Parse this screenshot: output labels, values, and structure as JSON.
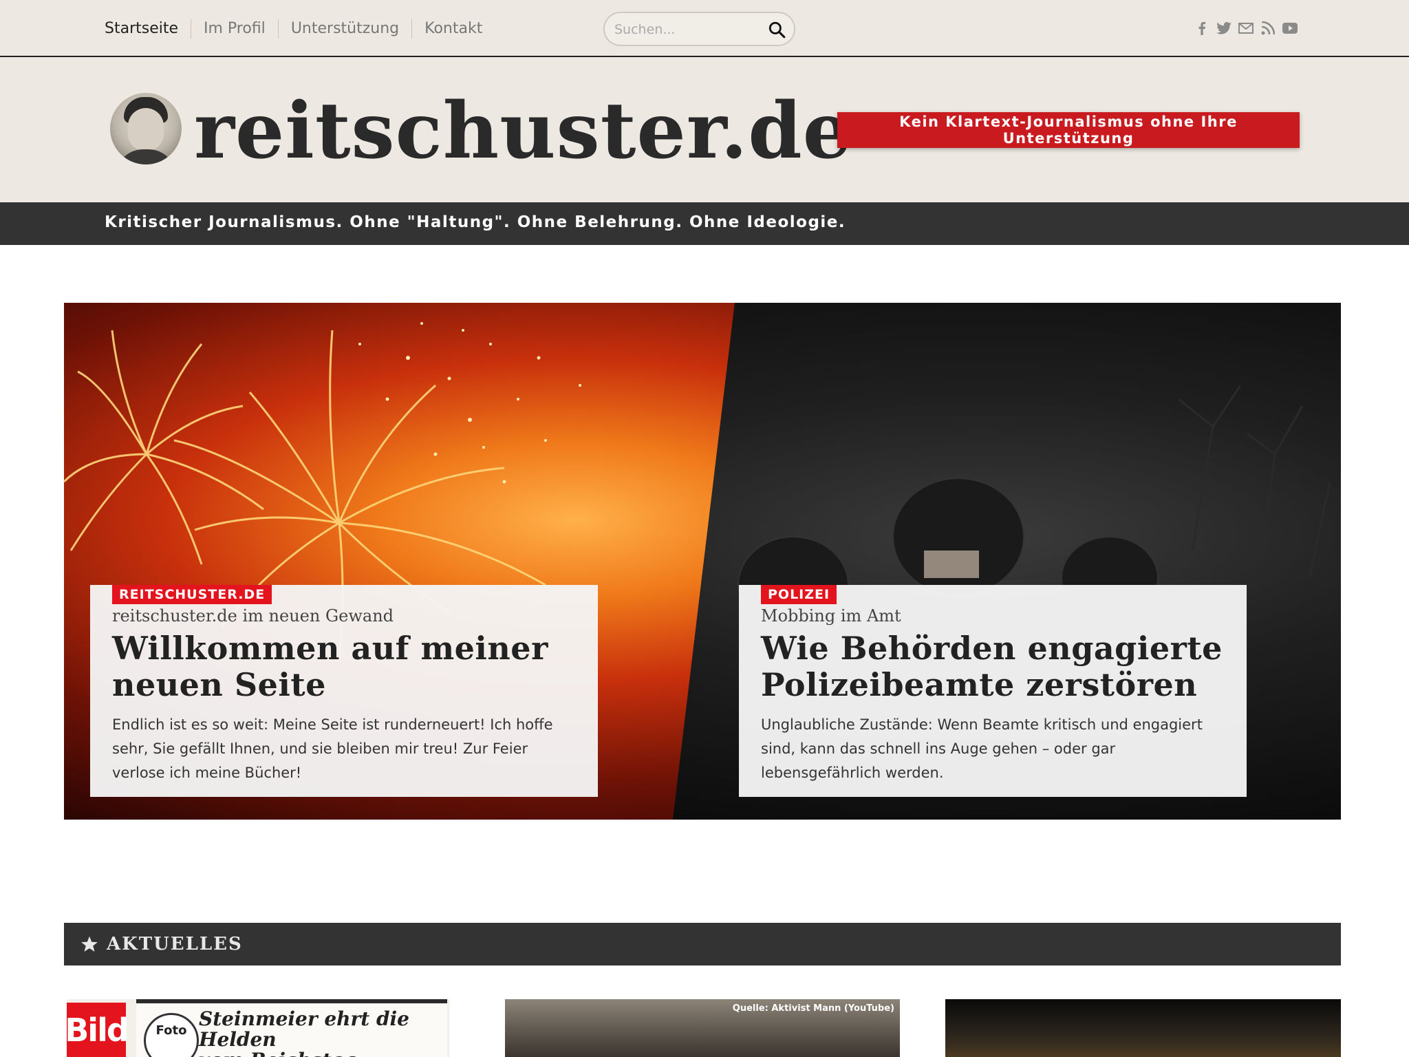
{
  "nav": {
    "items": [
      {
        "label": "Startseite"
      },
      {
        "label": "Im Profil"
      },
      {
        "label": "Unterstützung"
      },
      {
        "label": "Kontakt"
      }
    ]
  },
  "search": {
    "placeholder": "Suchen..."
  },
  "social": {
    "icons": [
      "facebook-icon",
      "twitter-icon",
      "mail-icon",
      "rss-icon",
      "youtube-icon"
    ]
  },
  "header": {
    "logo_text": "reitschuster.de",
    "support_button": "Kein Klartext-Journalismus ohne Ihre Unterstützung"
  },
  "tagline": "Kritischer Journalismus. Ohne \"Haltung\". Ohne Belehrung. Ohne Ideologie.",
  "hero": {
    "cards": [
      {
        "badge": "REITSCHUSTER.DE",
        "kicker": "reitschuster.de im neuen Gewand",
        "headline_line1": "Willkommen auf meiner",
        "headline_line2": "neuen Seite",
        "excerpt": "Endlich ist es so weit: Meine Seite ist runderneuert! Ich hoffe sehr, Sie gefällt Ihnen, und sie bleiben mir treu! Zur Feier verlose ich meine Bücher!"
      },
      {
        "badge": "POLIZEI",
        "kicker": "Mobbing im Amt",
        "headline_line1": "Wie Behörden engagierte",
        "headline_line2": "Polizeibeamte zerstören",
        "excerpt": "Unglaubliche Zustände: Wenn Beamte kritisch und engagiert sind, kann das schnell ins Auge gehen – oder gar lebensgefährlich werden."
      }
    ]
  },
  "section": {
    "title": "AKTUELLES",
    "icon": "star-icon"
  },
  "thumbs": {
    "bild_logo": "Bild",
    "stamp": "Foto",
    "news_title_line1": "Steinmeier ehrt die Helden",
    "news_title_line2": "vom Reichstag",
    "source": "Quelle: Aktivist Mann (YouTube)"
  },
  "colors": {
    "accent_red": "#c81a1f",
    "badge_red": "#e3141d",
    "bar_dark": "#333333",
    "header_bg": "#ede9e2"
  }
}
